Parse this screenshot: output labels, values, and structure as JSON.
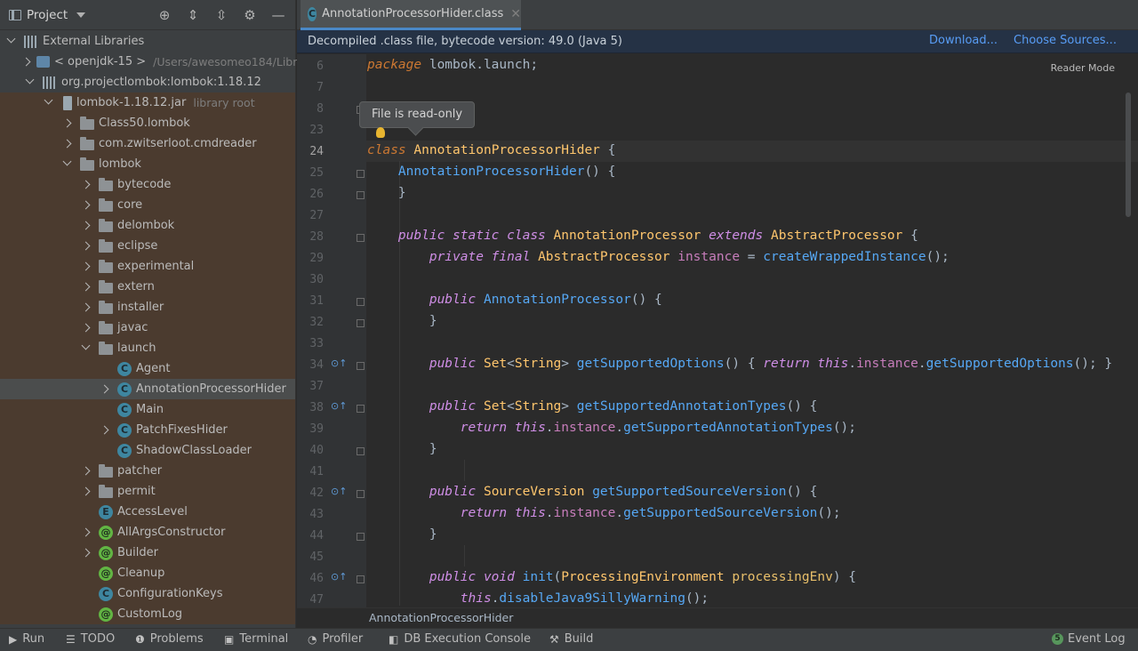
{
  "project_panel": {
    "title": "Project",
    "tree": [
      {
        "label": "External Libraries",
        "sub": ""
      },
      {
        "label": "< openjdk-15 >",
        "sub": "/Users/awesomeo184/Libr"
      },
      {
        "label": "org.projectlombok:lombok:1.18.12",
        "sub": ""
      },
      {
        "label": "lombok-1.18.12.jar",
        "sub": "library root"
      },
      {
        "label": "Class50.lombok",
        "sub": ""
      },
      {
        "label": "com.zwitserloot.cmdreader",
        "sub": ""
      },
      {
        "label": "lombok",
        "sub": ""
      },
      {
        "label": "bytecode",
        "sub": ""
      },
      {
        "label": "core",
        "sub": ""
      },
      {
        "label": "delombok",
        "sub": ""
      },
      {
        "label": "eclipse",
        "sub": ""
      },
      {
        "label": "experimental",
        "sub": ""
      },
      {
        "label": "extern",
        "sub": ""
      },
      {
        "label": "installer",
        "sub": ""
      },
      {
        "label": "javac",
        "sub": ""
      },
      {
        "label": "launch",
        "sub": ""
      },
      {
        "label": "Agent",
        "sub": ""
      },
      {
        "label": "AnnotationProcessorHider",
        "sub": ""
      },
      {
        "label": "Main",
        "sub": ""
      },
      {
        "label": "PatchFixesHider",
        "sub": ""
      },
      {
        "label": "ShadowClassLoader",
        "sub": ""
      },
      {
        "label": "patcher",
        "sub": ""
      },
      {
        "label": "permit",
        "sub": ""
      },
      {
        "label": "AccessLevel",
        "sub": ""
      },
      {
        "label": "AllArgsConstructor",
        "sub": ""
      },
      {
        "label": "Builder",
        "sub": ""
      },
      {
        "label": "Cleanup",
        "sub": ""
      },
      {
        "label": "ConfigurationKeys",
        "sub": ""
      },
      {
        "label": "CustomLog",
        "sub": ""
      }
    ]
  },
  "editor": {
    "tab_label": "AnnotationProcessorHider.class",
    "banner_text": "Decompiled .class file, bytecode version: 49.0 (Java 5)",
    "download_link": "Download...",
    "choose_sources_link": "Choose Sources...",
    "reader_mode": "Reader Mode",
    "tooltip": "File is read-only",
    "breadcrumb": "AnnotationProcessorHider",
    "line_numbers": [
      "6",
      "7",
      "8",
      "23",
      "24",
      "25",
      "26",
      "27",
      "28",
      "29",
      "30",
      "31",
      "32",
      "33",
      "34",
      "37",
      "38",
      "39",
      "40",
      "41",
      "42",
      "43",
      "44",
      "45",
      "46",
      "47"
    ]
  },
  "bottom_bar": {
    "run": "Run",
    "todo": "TODO",
    "problems": "Problems",
    "terminal": "Terminal",
    "profiler": "Profiler",
    "db_console": "DB Execution Console",
    "build": "Build",
    "event_log": "Event Log"
  }
}
